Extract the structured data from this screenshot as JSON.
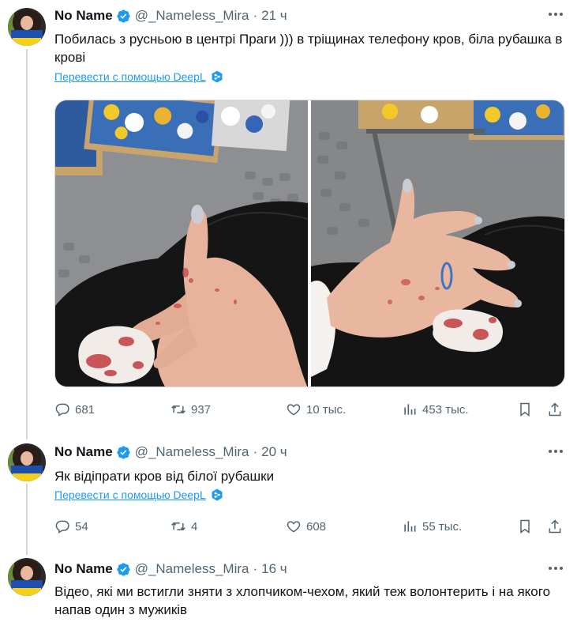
{
  "tweets": [
    {
      "author": "No Name",
      "handle": "@_Nameless_Mira",
      "separator": "·",
      "time": "21 ч",
      "text": "Побилась з русньою в центрі Праги )))  в тріщинах телефону кров, біла рубашка в крові",
      "translate": "Перевести с помощью DeepL",
      "stats": {
        "replies": "681",
        "retweets": "937",
        "likes": "10 тыс.",
        "views": "453 тыс."
      }
    },
    {
      "author": "No Name",
      "handle": "@_Nameless_Mira",
      "separator": "·",
      "time": "20 ч",
      "text": "Як відіпрати кров від білої рубашки",
      "translate": "Перевести с помощью DeepL",
      "stats": {
        "replies": "54",
        "retweets": "4",
        "likes": "608",
        "views": "55 тыс."
      }
    },
    {
      "author": "No Name",
      "handle": "@_Nameless_Mira",
      "separator": "·",
      "time": "16 ч",
      "text": "Відео, які ми встигли зняти з хлопчиком-чехом, який теж волонтерить і на якого напав один з мужиків"
    }
  ],
  "icons": {
    "verified": "verified-badge-icon",
    "more": "more-options-icon",
    "reply": "reply-icon",
    "retweet": "retweet-icon",
    "like": "like-icon",
    "views": "views-icon",
    "bookmark": "bookmark-icon",
    "share": "share-icon",
    "deepl": "deepl-icon"
  },
  "colors": {
    "verified": "#1d9bf0",
    "link": "#1d9bf0",
    "secondary_text": "#536471",
    "divider": "#cfd9de"
  }
}
